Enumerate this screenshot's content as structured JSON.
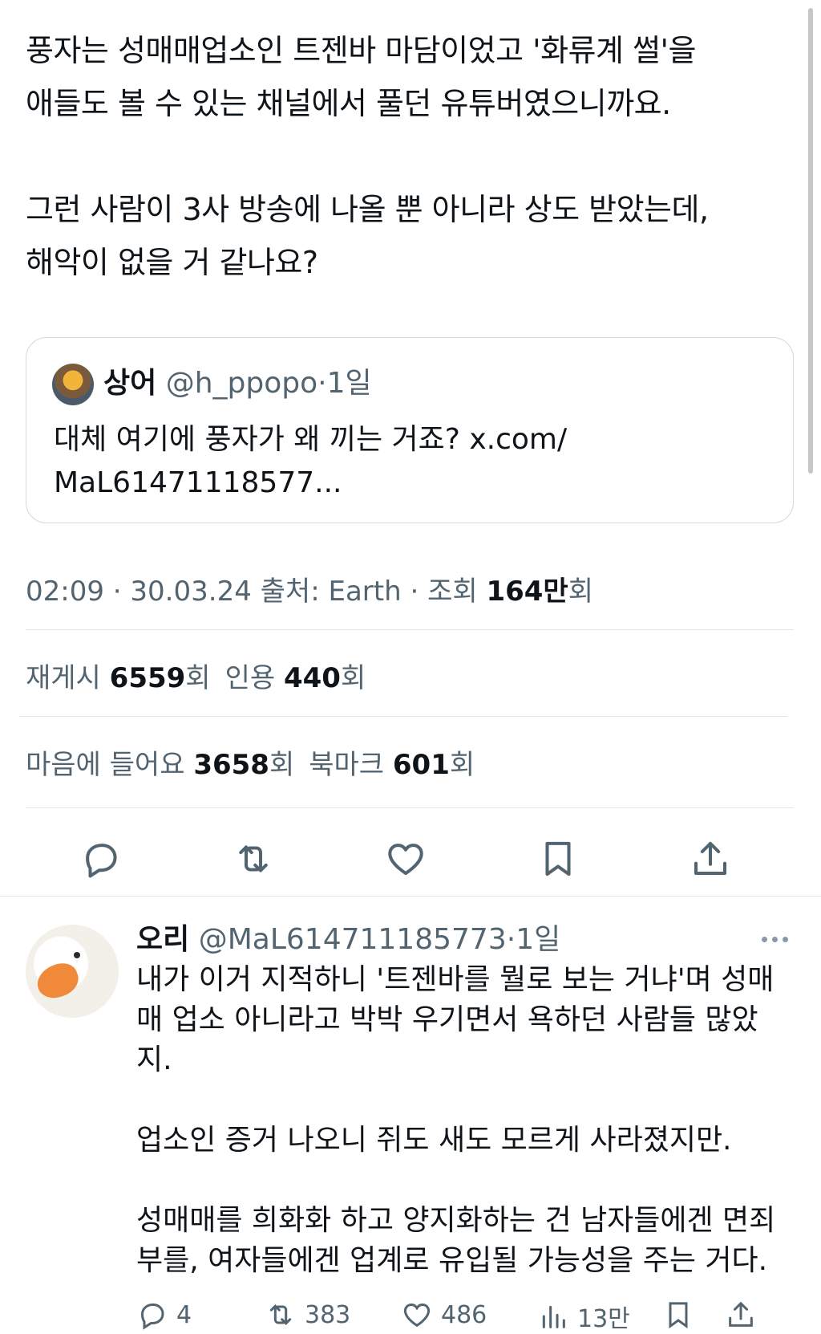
{
  "tweet": {
    "lines": [
      "풍자는 성매매업소인 트젠바 마담이었고 '화류계 썰'을",
      "애들도 볼 수 있는 채널에서 풀던 유튜버였으니까요.",
      "그런 사람이 3사 방송에 나올 뿐 아니라 상도 받았는데,",
      "해악이 없을 거 같나요?"
    ]
  },
  "quote": {
    "name": "상어",
    "handle": "@h_ppopo",
    "dot": "·",
    "time": "1일",
    "line1": "대체 여기에 풍자가 왜 끼는 거죠? x.com/",
    "line2": "MaL61471118577..."
  },
  "meta": {
    "time": "02:09",
    "date": "30.03.24",
    "source_label": "출처: Earth",
    "views_label": "조회",
    "views_value": "164만",
    "views_unit": "회"
  },
  "stats": {
    "reposts_label": "재게시",
    "reposts_value": "6559",
    "quotes_label": "인용",
    "quotes_value": "440",
    "likes_label": "마음에 들어요",
    "likes_value": "3658",
    "bookmarks_label": "북마크",
    "bookmarks_value": "601",
    "unit": "회"
  },
  "actions": [
    "reply-icon",
    "repost-icon",
    "like-icon",
    "bookmark-icon",
    "share-icon"
  ],
  "reply": {
    "name": "오리",
    "handle": "@MaL614711185773",
    "dot": "·",
    "time": "1일",
    "paragraphs": [
      [
        "내가 이거 지적하니 '트젠바를 뭘로 보는 거냐'며 성매",
        "매 업소 아니라고 박박 우기면서 욕하던 사람들 많았",
        "지."
      ],
      [
        "업소인 증거 나오니 쥐도 새도 모르게 사라졌지만."
      ],
      [
        "성매매를 희화화 하고 양지화하는 건 남자들에겐 면죄",
        "부를, 여자들에겐 업계로 유입될 가능성을 주는 거다."
      ]
    ],
    "counts": {
      "replies": "4",
      "reposts": "383",
      "likes": "486",
      "views": "13만"
    }
  }
}
